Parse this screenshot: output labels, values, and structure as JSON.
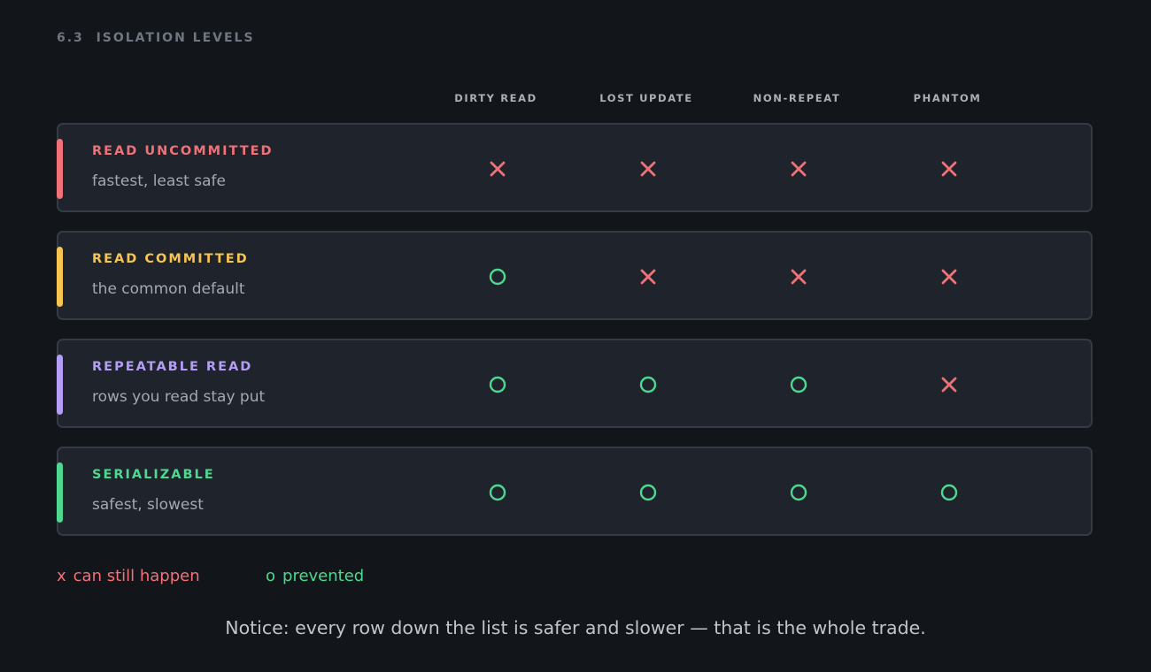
{
  "section": {
    "number": "6.3",
    "title": "ISOLATION LEVELS"
  },
  "columns": [
    "DIRTY READ",
    "LOST UPDATE",
    "NON-REPEAT",
    "PHANTOM"
  ],
  "rows": [
    {
      "name": "READ UNCOMMITTED",
      "description": "fastest, least safe",
      "accent": "#f07178",
      "marks": [
        "x",
        "x",
        "x",
        "x"
      ]
    },
    {
      "name": "READ COMMITTED",
      "description": "the common default",
      "accent": "#f5c451",
      "marks": [
        "o",
        "x",
        "x",
        "x"
      ]
    },
    {
      "name": "REPEATABLE READ",
      "description": "rows you read stay put",
      "accent": "#b39df5",
      "marks": [
        "o",
        "o",
        "o",
        "x"
      ]
    },
    {
      "name": "SERIALIZABLE",
      "description": "safest, slowest",
      "accent": "#4ed88f",
      "marks": [
        "o",
        "o",
        "o",
        "o"
      ]
    }
  ],
  "legend": {
    "happen": {
      "symbol": "x",
      "label": "can still happen",
      "color": "#f07178"
    },
    "prevented": {
      "symbol": "o",
      "label": "prevented",
      "color": "#4ed88f"
    }
  },
  "notice": "Notice: every row down the list is safer and slower — that is the whole trade.",
  "colors": {
    "x_mark": "#f07178",
    "o_mark": "#4ed88f"
  }
}
